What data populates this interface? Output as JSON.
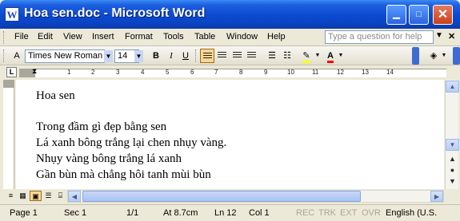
{
  "window": {
    "title": "Hoa sen.doc - Microsoft Word",
    "app_icon_letter": "W",
    "minimize_icon": "minimize-icon",
    "maximize_icon": "maximize-icon",
    "close_icon": "close-icon"
  },
  "menu": {
    "items": [
      "File",
      "Edit",
      "View",
      "Insert",
      "Format",
      "Tools",
      "Table",
      "Window",
      "Help"
    ],
    "help_placeholder": "Type a question for help"
  },
  "toolbar": {
    "style_value": "Times New Roman",
    "size_value": "14",
    "bold": "B",
    "italic": "I",
    "underline": "U",
    "highlight_color": "#ffff00",
    "font_color": "#ff0000",
    "font_color_label": "A"
  },
  "ruler": {
    "tab_selector": "L",
    "numbers": [
      "1",
      "2",
      "3",
      "4",
      "5",
      "6",
      "7",
      "8",
      "9",
      "10",
      "11",
      "12",
      "13",
      "14"
    ]
  },
  "document": {
    "lines": [
      "Hoa sen",
      "",
      "Trong đầm gì đẹp bằng sen",
      "Lá xanh bông trắng lại chen nhụy vàng.",
      "Nhụy vàng bông trắng lá xanh",
      "Gần bùn mà chẳng hôi tanh mùi bùn"
    ]
  },
  "status": {
    "page": "Page 1",
    "sec": "Sec 1",
    "pages": "1/1",
    "at": "At 8.7cm",
    "ln": "Ln 12",
    "col": "Col 1",
    "rec": "REC",
    "trk": "TRK",
    "ext": "EXT",
    "ovr": "OVR",
    "language": "English (U.S."
  },
  "colors": {
    "titlebar": "#0a4ad0",
    "active_button": "#fbd792"
  }
}
